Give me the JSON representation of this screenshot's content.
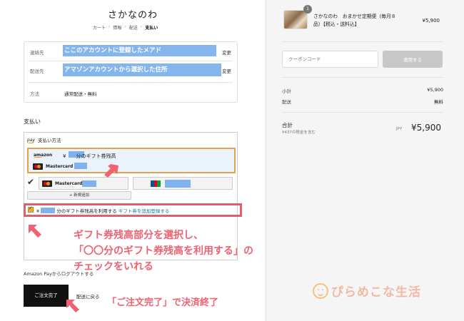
{
  "header": {
    "shop_name": "さかなのわ",
    "breadcrumb": [
      "カート",
      "情報",
      "配送",
      "支払い"
    ]
  },
  "info": {
    "contact_label": "連絡先",
    "contact_value": "ここのアカウントに登録したメアド",
    "shipping_label": "配送先",
    "shipping_value": "アマゾンアカウントから選択した住所",
    "method_label": "方法",
    "method_value": "通常配送・無料",
    "change_label": "変更"
  },
  "payment": {
    "section_title": "支払い",
    "widget_logo": "pay",
    "widget_title": "支払い方法",
    "amazon_logo": "amazon",
    "gift_card_text": "¥　　分のギフト券残高",
    "card_label": "Mastercard",
    "new_add": "+ 新規追加",
    "gc_use_prefix": "¥",
    "gc_use_text": "分のギフト券残高を利用する",
    "gc_add_link": "ギフト券を追加登録する",
    "logout": "Amazon Payからログアウトする"
  },
  "actions": {
    "complete_order": "ご注文完了",
    "back_to_shipping": "配送に戻る"
  },
  "annotations": {
    "line1": "ギフト券残高部分を選択し、",
    "line2": "「〇〇分のギフト券残高を利用する」の",
    "line3": "チェックをいれる",
    "complete_note": "「ご注文完了」で決済終了"
  },
  "watermark": "ぴらめこな生活",
  "summary": {
    "qty": "1",
    "product_name": "さかなのわ　おまかせ定期便（毎月８品）【税込・送料込】",
    "product_price": "¥5,900",
    "coupon_placeholder": "クーポンコード",
    "coupon_button": "適用する",
    "subtotal_label": "小計",
    "subtotal_value": "¥5,900",
    "shipping_label": "配送",
    "shipping_value": "無料",
    "total_label": "合計",
    "tax_note": "¥437の税金を含む",
    "currency": "JPY",
    "total_value": "¥5,900"
  },
  "colors": {
    "annotation": "#f06272",
    "highlight_box": "#e05f6f",
    "selected_border": "#e4a04b",
    "link": "#0a7a9e"
  }
}
